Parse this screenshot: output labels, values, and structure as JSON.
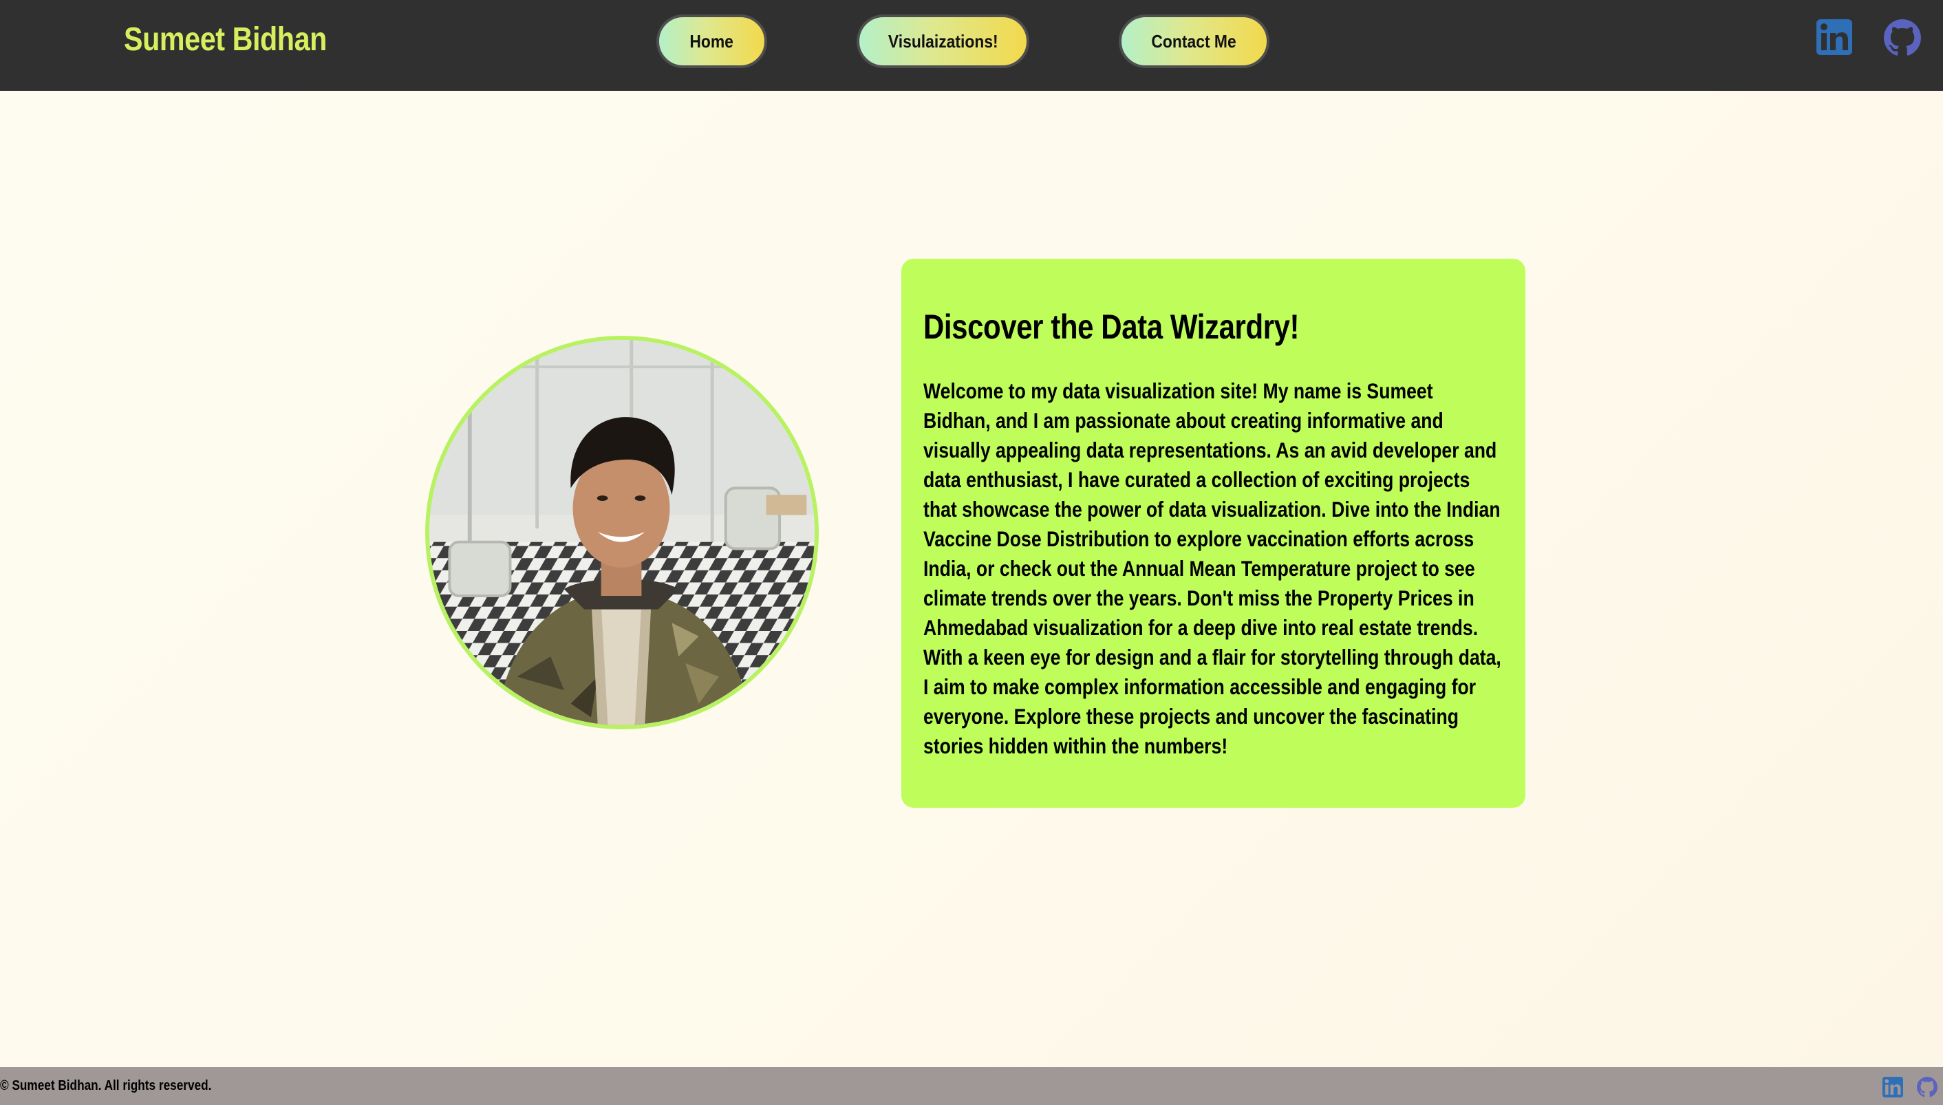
{
  "header": {
    "brand": "Sumeet Bidhan",
    "nav": [
      {
        "label": "Home"
      },
      {
        "label": "Visulaizations!"
      },
      {
        "label": "Contact Me"
      }
    ],
    "social_icons": [
      "linkedin-icon",
      "github-icon"
    ]
  },
  "main": {
    "title": "Discover the Data Wizardry!",
    "body": "Welcome to my data visualization site! My name is Sumeet Bidhan, and I am passionate about creating informative and visually appealing data representations. As an avid developer and data enthusiast, I have curated a collection of exciting projects that showcase the power of data visualization. Dive into the Indian Vaccine Dose Distribution to explore vaccination efforts across India, or check out the Annual Mean Temperature project to see climate trends over the years. Don't miss the Property Prices in Ahmedabad visualization for a deep dive into real estate trends. With a keen eye for design and a flair for storytelling through data, I aim to make complex information accessible and engaging for everyone. Explore these projects and uncover the fascinating stories hidden within the numbers!"
  },
  "footer": {
    "copyright": "© Sumeet Bidhan. All rights reserved."
  },
  "colors": {
    "header_bg": "#313030",
    "brand": "#d6ef5e",
    "card_bg": "#befd5a",
    "photo_ring": "#b8f262",
    "footer_bg": "#a09897",
    "linkedin": "#2e6fb7",
    "github": "#5a63bd"
  }
}
